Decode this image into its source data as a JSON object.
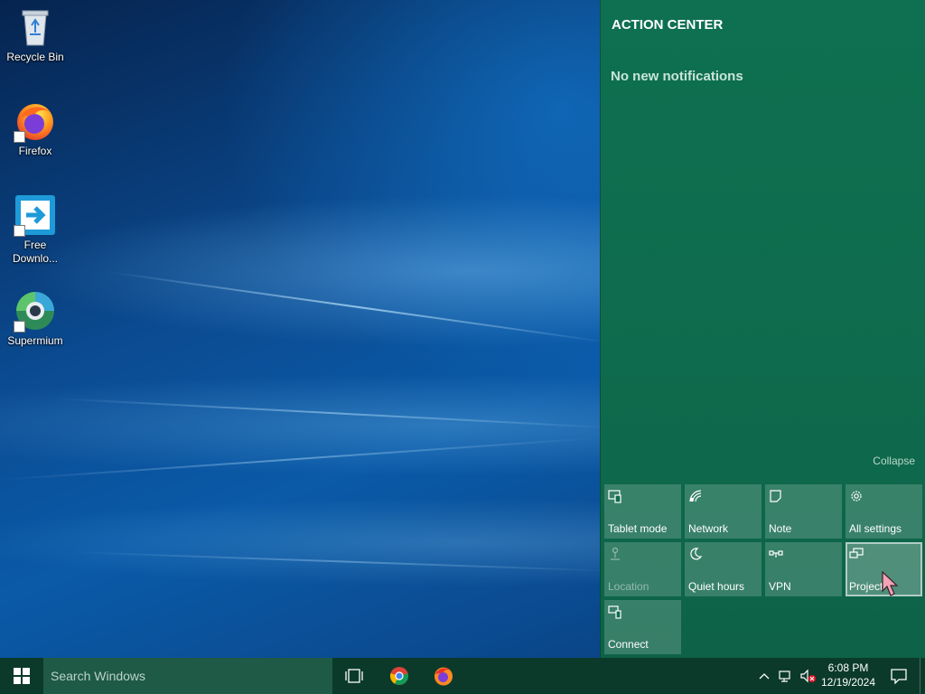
{
  "desktop": {
    "icons": [
      {
        "label": "Recycle Bin",
        "icon": "recycle-bin-icon"
      },
      {
        "label": "Firefox",
        "icon": "firefox-icon"
      },
      {
        "label": "Free Downlo...",
        "icon": "free-download-manager-icon"
      },
      {
        "label": "Supermium",
        "icon": "supermium-icon"
      }
    ]
  },
  "action_center": {
    "title": "ACTION CENTER",
    "empty_message": "No new notifications",
    "collapse_label": "Collapse",
    "tiles": [
      {
        "label": "Tablet mode",
        "icon": "tablet-mode-icon",
        "state": "normal"
      },
      {
        "label": "Network",
        "icon": "network-icon",
        "state": "normal"
      },
      {
        "label": "Note",
        "icon": "note-icon",
        "state": "normal"
      },
      {
        "label": "All settings",
        "icon": "gear-icon",
        "state": "normal"
      },
      {
        "label": "Location",
        "icon": "location-icon",
        "state": "disabled"
      },
      {
        "label": "Quiet hours",
        "icon": "moon-icon",
        "state": "normal"
      },
      {
        "label": "VPN",
        "icon": "vpn-icon",
        "state": "normal"
      },
      {
        "label": "Project",
        "icon": "project-icon",
        "state": "hovered"
      },
      {
        "label": "Connect",
        "icon": "connect-icon",
        "state": "normal"
      }
    ],
    "colors": {
      "background": "#0f6b4d",
      "tile": "#3f8a70"
    }
  },
  "taskbar": {
    "search_placeholder": "Search Windows",
    "pinned": [
      {
        "name": "task-view",
        "icon": "task-view-icon"
      },
      {
        "name": "chrome",
        "icon": "chrome-icon"
      },
      {
        "name": "firefox",
        "icon": "firefox-icon"
      }
    ],
    "tray": {
      "icons": [
        "chevron-up-icon",
        "network-tray-icon",
        "volume-muted-icon"
      ],
      "time": "6:08 PM",
      "date": "12/19/2024"
    },
    "color": "#0b3a2b"
  }
}
